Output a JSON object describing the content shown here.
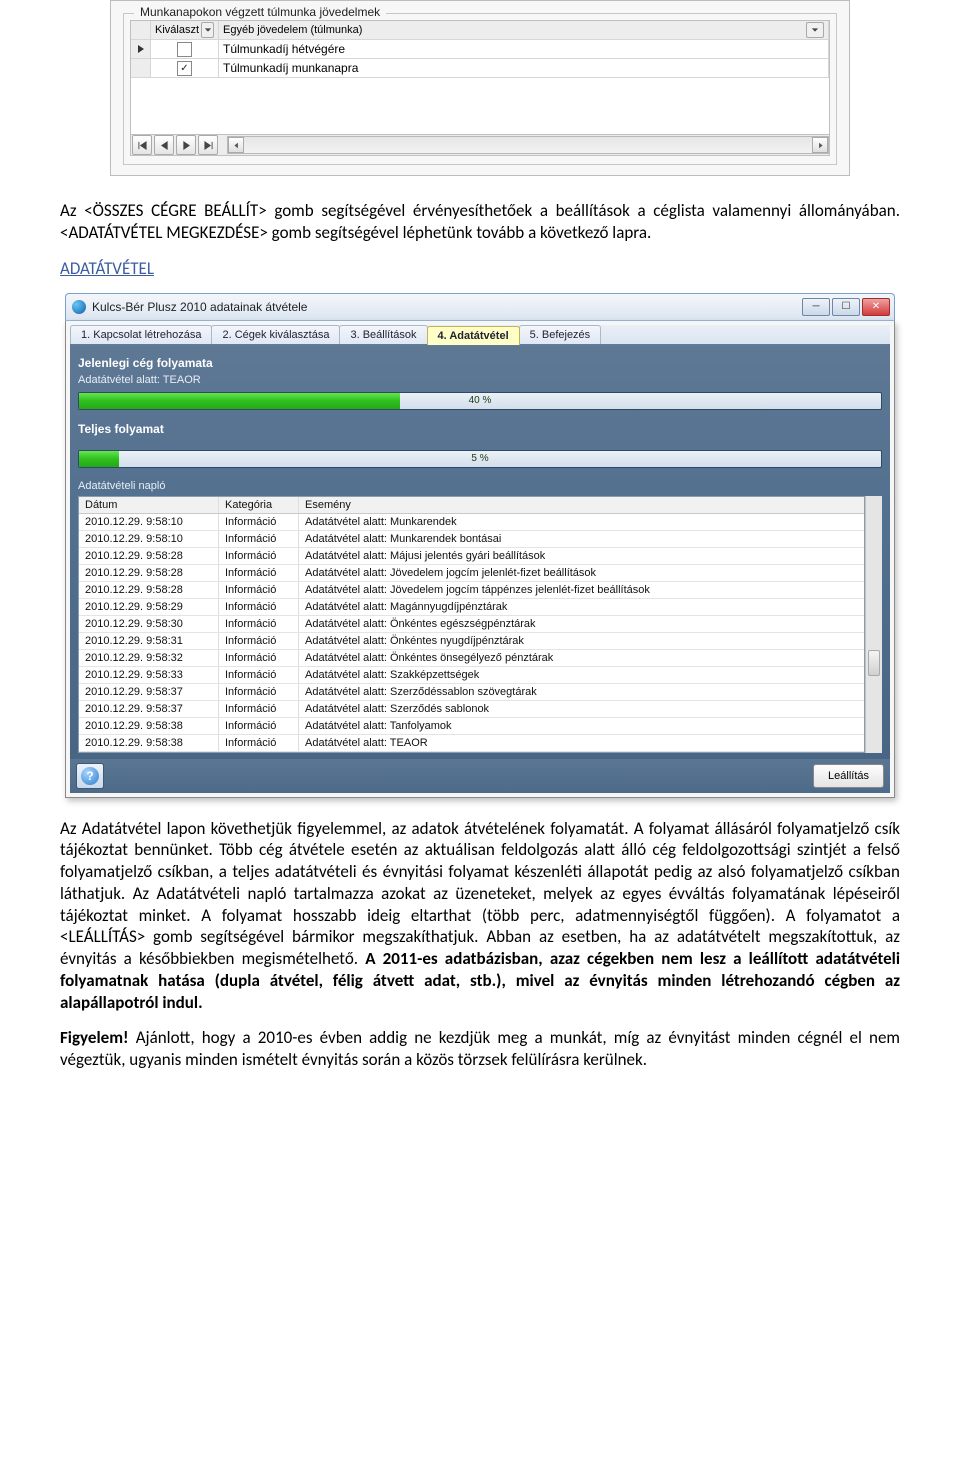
{
  "shot1": {
    "fieldset_legend": "Munkanapokon végzett túlmunka jövedelmek",
    "col_select": "Kiválaszt",
    "col_type": "Egyéb jövedelem (túlmunka)",
    "rows": [
      {
        "checked": false,
        "label": "Túlmunkadíj hétvégére"
      },
      {
        "checked": true,
        "label": "Túlmunkadíj munkanapra"
      }
    ]
  },
  "para1": "Az <ÖSSZES CÉGRE BEÁLLÍT> gomb segítségével érvényesíthetőek a beállítások a céglista valamennyi állományában. <ADATÁTVÉTEL MEGKEZDÉSE> gomb segítségével léphetünk tovább a következő lapra.",
  "section_link": "ADATÁTVÉTEL",
  "win": {
    "title": "Kulcs-Bér Plusz 2010 adatainak átvétele",
    "tabs": [
      "1. Kapcsolat létrehozása",
      "2. Cégek kiválasztása",
      "3. Beállítások",
      "4. Adatátvétel",
      "5. Befejezés"
    ],
    "active_tab_index": 3,
    "current": {
      "title": "Jelenlegi cég folyamata",
      "sub": "Adatátvétel alatt: TEAOR",
      "percent": 40,
      "label": "40 %"
    },
    "total": {
      "title": "Teljes folyamat",
      "percent": 5,
      "label": "5 %"
    },
    "log_title": "Adatátvételi napló",
    "log_headers": {
      "date": "Dátum",
      "cat": "Kategória",
      "evt": "Esemény"
    },
    "log": [
      {
        "date": "2010.12.29. 9:58:10",
        "cat": "Információ",
        "evt": "Adatátvétel alatt: Munkarendek"
      },
      {
        "date": "2010.12.29. 9:58:10",
        "cat": "Információ",
        "evt": "Adatátvétel alatt: Munkarendek bontásai"
      },
      {
        "date": "2010.12.29. 9:58:28",
        "cat": "Információ",
        "evt": "Adatátvétel alatt: Májusi jelentés gyári beállítások"
      },
      {
        "date": "2010.12.29. 9:58:28",
        "cat": "Információ",
        "evt": "Adatátvétel alatt: Jövedelem jogcím jelenlét-fizet beállítások"
      },
      {
        "date": "2010.12.29. 9:58:28",
        "cat": "Információ",
        "evt": "Adatátvétel alatt: Jövedelem jogcím táppénzes jelenlét-fizet beállítások"
      },
      {
        "date": "2010.12.29. 9:58:29",
        "cat": "Információ",
        "evt": "Adatátvétel alatt: Magánnyugdíjpénztárak"
      },
      {
        "date": "2010.12.29. 9:58:30",
        "cat": "Információ",
        "evt": "Adatátvétel alatt: Önkéntes egészségpénztárak"
      },
      {
        "date": "2010.12.29. 9:58:31",
        "cat": "Információ",
        "evt": "Adatátvétel alatt: Önkéntes nyugdíjpénztárak"
      },
      {
        "date": "2010.12.29. 9:58:32",
        "cat": "Információ",
        "evt": "Adatátvétel alatt: Önkéntes önsegélyező pénztárak"
      },
      {
        "date": "2010.12.29. 9:58:33",
        "cat": "Információ",
        "evt": "Adatátvétel alatt: Szakképzettségek"
      },
      {
        "date": "2010.12.29. 9:58:37",
        "cat": "Információ",
        "evt": "Adatátvétel alatt: Szerződéssablon szövegtárak"
      },
      {
        "date": "2010.12.29. 9:58:37",
        "cat": "Információ",
        "evt": "Adatátvétel alatt: Szerződés sablonok"
      },
      {
        "date": "2010.12.29. 9:58:38",
        "cat": "Információ",
        "evt": "Adatátvétel alatt: Tanfolyamok"
      },
      {
        "date": "2010.12.29. 9:58:38",
        "cat": "Információ",
        "evt": "Adatátvétel alatt: TEAOR"
      }
    ],
    "stop_label": "Leállítás"
  },
  "para2_plain": "Az Adatátvétel lapon követhetjük figyelemmel, az adatok átvételének folyamatát. A folyamat állásáról folyamatjelző csík tájékoztat bennünket. Több cég átvétele esetén az aktuálisan feldolgozás alatt álló cég feldolgozottsági szintjét a felső folyamatjelző csíkban, a teljes adatátvételi és évnyitási folyamat készenléti állapotát pedig az alsó folyamatjelző csíkban láthatjuk. Az Adatátvételi napló tartalmazza azokat az üzeneteket, melyek az egyes évváltás folyamatának lépéseiről tájékoztat minket. A folyamat hosszabb ideig eltarthat (több perc, adatmennyiségtől függően). A folyamatot a <LEÁLLÍTÁS> gomb segítségével bármikor megszakíthatjuk. Abban az esetben, ha az adatátvételt megszakítottuk, az évnyitás a későbbiekben megismételhető. ",
  "para2_bold": "A 2011-es adatbázisban, azaz cégekben nem lesz a leállított adatátvételi folyamatnak hatása (dupla átvétel, félig átvett adat, stb.), mivel az évnyitás minden létrehozandó cégben az alapállapotról indul.",
  "para3_lead": "Figyelem!",
  "para3_rest": " Ajánlott, hogy a 2010-es évben addig ne kezdjük meg a munkát, míg az évnyitást minden cégnél el nem végeztük, ugyanis minden ismételt évnyitás során a közös törzsek felülírásra kerülnek."
}
